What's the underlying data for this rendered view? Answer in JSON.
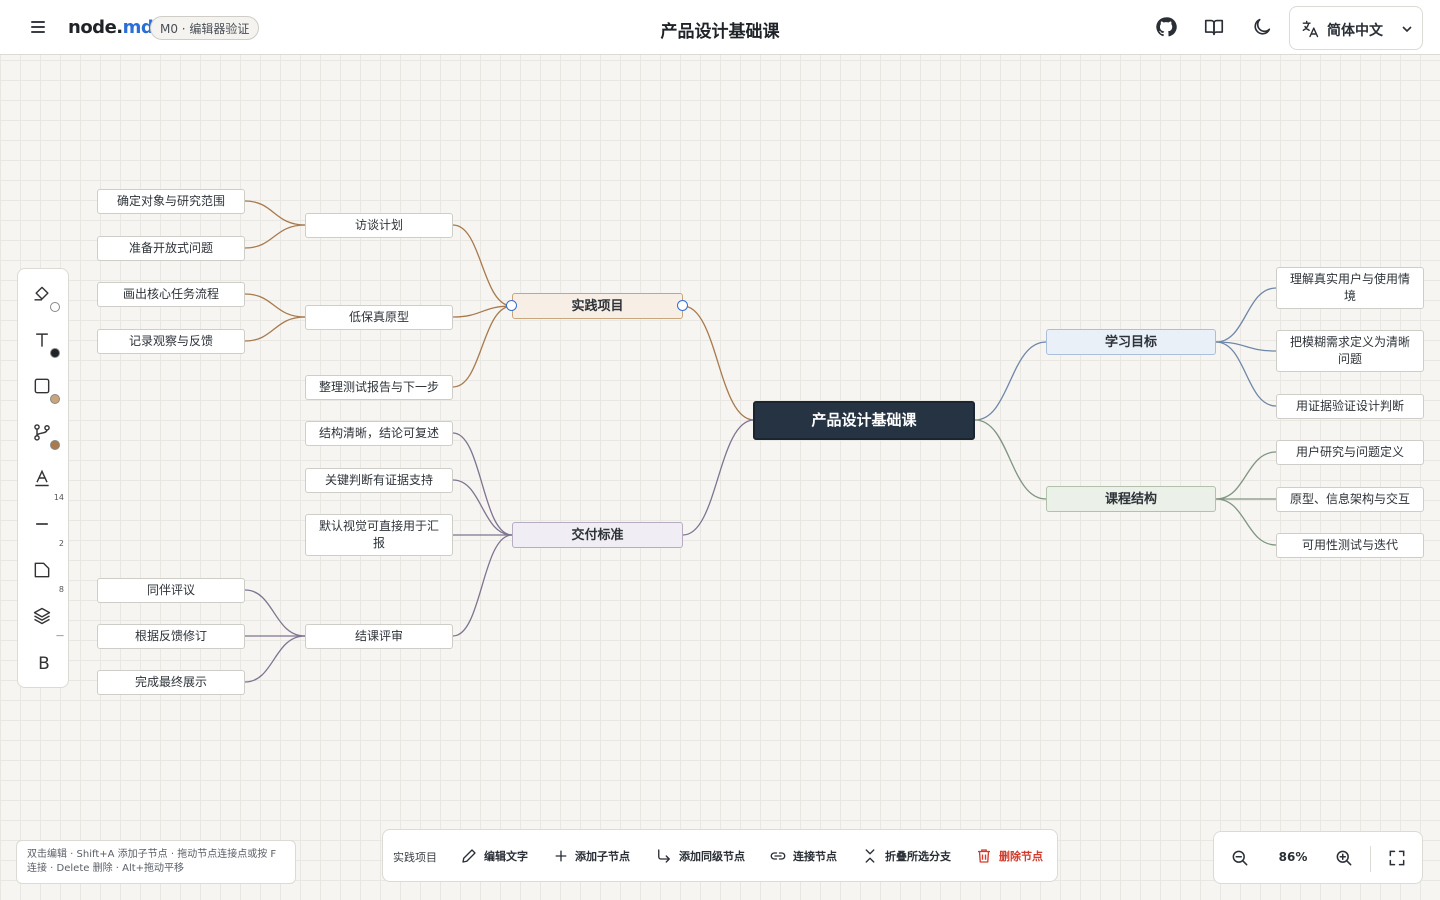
{
  "header": {
    "logo_main": "node.",
    "logo_accent": "md",
    "version_badge": "M0 · 编辑器验证",
    "title": "产品设计基础课",
    "icons": [
      "menu-icon",
      "github-icon",
      "book-icon",
      "moon-icon",
      "translate-icon",
      "chevron-down-icon"
    ],
    "language": "简体中文"
  },
  "mindmap": {
    "root": "产品设计基础课",
    "branches": {
      "practice": "实践项目",
      "delivery": "交付标准",
      "goals": "学习目标",
      "structure": "课程结构"
    },
    "practice_children": {
      "interview": "访谈计划",
      "prototype": "低保真原型",
      "report": "整理测试报告与下一步"
    },
    "interview_children": [
      "确定对象与研究范围",
      "准备开放式问题"
    ],
    "prototype_children": [
      "画出核心任务流程",
      "记录观察与反馈"
    ],
    "delivery_children": {
      "clarity": "结构清晰，结论可复述",
      "evidence": "关键判断有证据支持",
      "visual": "默认视觉可直接用于汇报",
      "review": "结课评审"
    },
    "review_children": [
      "同伴评议",
      "根据反馈修订",
      "完成最终展示"
    ],
    "goals_children": [
      "理解真实用户与使用情境",
      "把模糊需求定义为清晰问题",
      "用证据验证设计判断"
    ],
    "structure_children": [
      "用户研究与问题定义",
      "原型、信息架构与交互",
      "可用性测试与迭代"
    ]
  },
  "colors": {
    "practice": "#a87a4e",
    "delivery": "#7f7391",
    "goals": "#6f87a8",
    "structure": "#7f9580",
    "root_bg": "#263342",
    "accent": "#2b6fd6",
    "danger": "#d33b2c"
  },
  "toolbar": {
    "tools": [
      "fill-icon",
      "text-color-icon",
      "border-color-icon",
      "branch-color-icon",
      "font-size-icon",
      "line-width-icon",
      "corner-radius-icon",
      "layer-icon",
      "bold-icon"
    ],
    "font_size": "14",
    "line_width": "2",
    "corner_radius": "8",
    "layer_value": "—",
    "bold_label": "B"
  },
  "hint": "双击编辑 · Shift+A 添加子节点 · 拖动节点连接点或按 F 连接 · Delete 删除 · Alt+拖动平移",
  "action_bar": {
    "selected": "实践项目",
    "edit": "编辑文字",
    "add_child": "添加子节点",
    "add_sibling": "添加同级节点",
    "connect": "连接节点",
    "collapse": "折叠所选分支",
    "delete": "删除节点"
  },
  "zoom": {
    "level": "86%"
  }
}
